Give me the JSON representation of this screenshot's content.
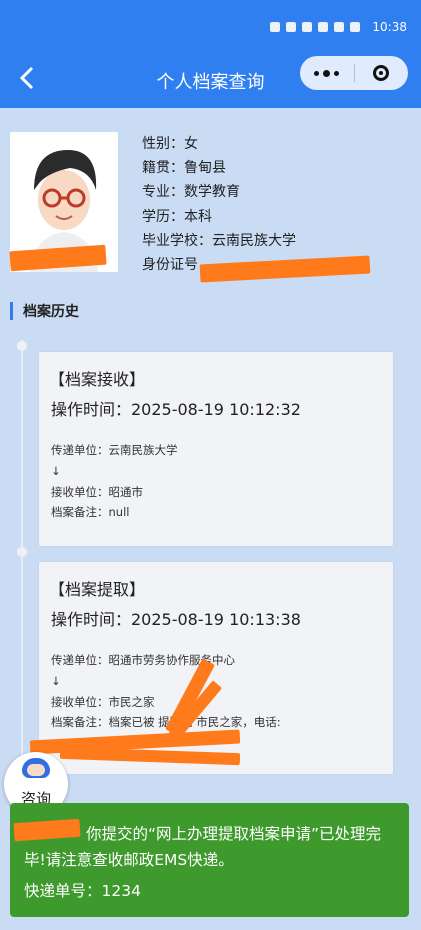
{
  "status_bar": {
    "time": "10:38"
  },
  "nav": {
    "title": "个人档案查询"
  },
  "profile": {
    "gender": "性别：女",
    "origin": "籍贯：鲁甸县",
    "major": "专业：数学教育",
    "education": "学历：本科",
    "school": "毕业学校：云南民族大学",
    "id_label": "身份证号"
  },
  "history": {
    "heading": "档案历史",
    "records": [
      {
        "title": "【档案接收】",
        "time": "操作时间：2025-08-19 10:12:32",
        "from": "传递单位：云南民族大学",
        "arrow": "↓",
        "to": "接收单位：昭通市",
        "note": "档案备注：null"
      },
      {
        "title": "【档案提取】",
        "time": "操作时间：2025-08-19 10:13:38",
        "from": "传递单位：昭通市劳务协作服务中心",
        "arrow": "↓",
        "to": "接收单位：市民之家",
        "note": "档案备注：档案已被    提取到 市民之家，电话:"
      }
    ]
  },
  "consult": {
    "label": "咨询"
  },
  "notice": {
    "message": "你提交的“网上办理提取档案申请”已处理完毕!请注意查收邮政EMS快递。",
    "tracking": "快递单号：1234"
  },
  "colors": {
    "brand": "#2f7ff0",
    "notice_bg": "#3e9a2c",
    "page_bg": "#c9dcf4",
    "redaction": "#ff7a1a"
  }
}
